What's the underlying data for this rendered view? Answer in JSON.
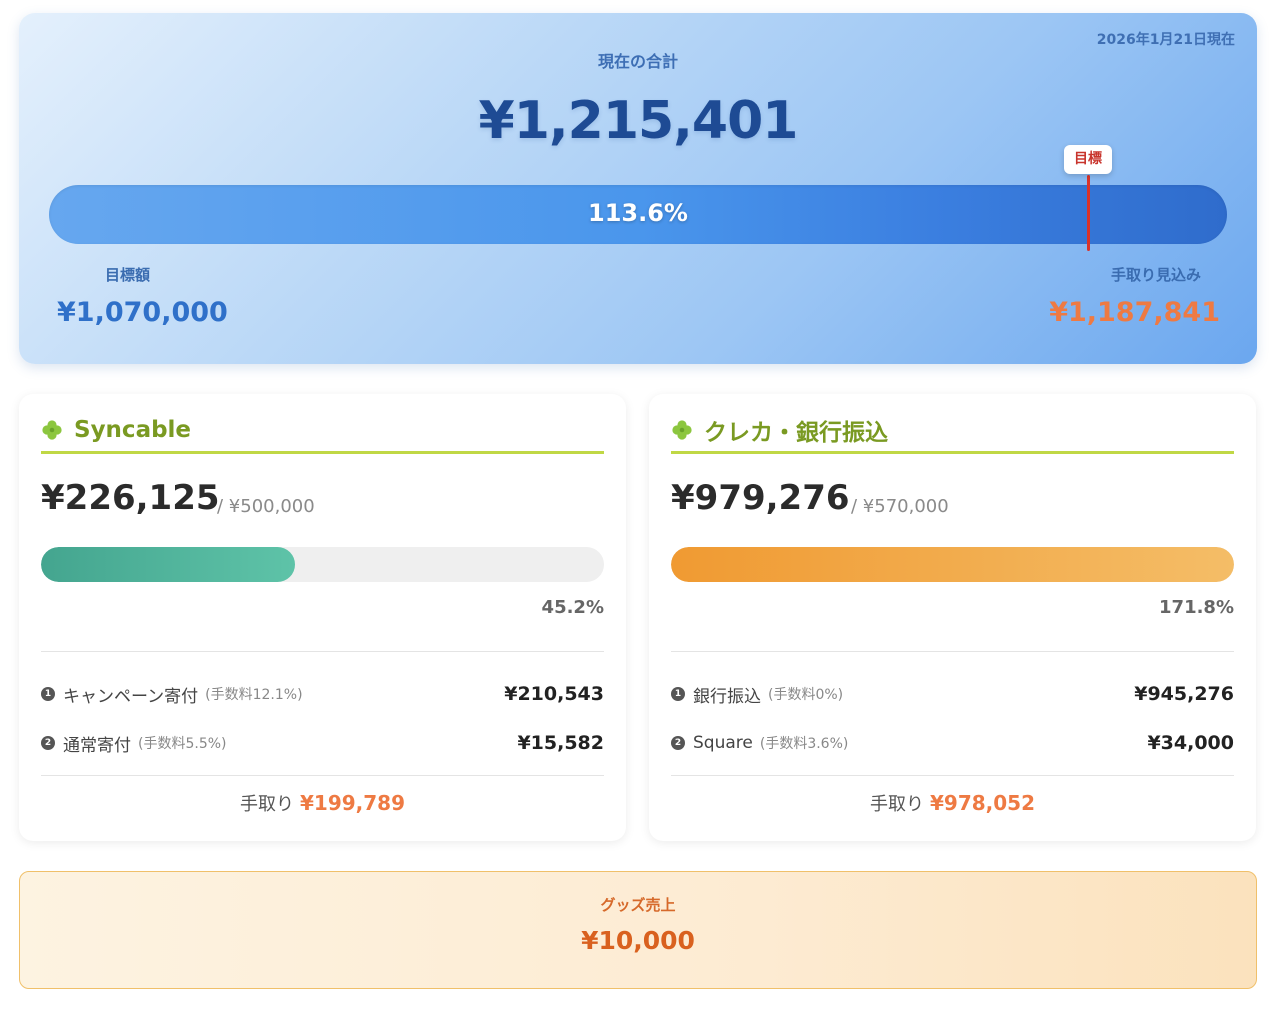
{
  "colors": {
    "hero_total": "#1e4b94",
    "accent_orange": "#ee7a43",
    "goal_marker": "#d9322a",
    "card_title": "#7a9a22",
    "card_title_underline": "#c0d845",
    "syncable_bar": "#4fb59d",
    "bank_bar": "#f2a845"
  },
  "summary": {
    "date": "2026年1月21日現在",
    "label": "現在の合計",
    "total": "¥1,215,401",
    "progress_text": "113.6%",
    "progress_value": 1.136,
    "goal_marker_label": "目標",
    "target_label": "目標額",
    "target_value": "¥1,070,000",
    "net_label": "手取り見込み",
    "net_value": "¥1,187,841"
  },
  "sources": [
    {
      "icon": "clover-icon",
      "title": "Syncable",
      "amount": "¥226,125",
      "target": "/ ¥500,000",
      "progress_text": "45.2%",
      "progress_value": 0.452,
      "items": [
        {
          "num": "1",
          "label": "キャンペーン寄付",
          "fee": "(手数料12.1%)",
          "value": "¥210,543"
        },
        {
          "num": "2",
          "label": "通常寄付",
          "fee": "(手数料5.5%)",
          "value": "¥15,582"
        }
      ],
      "net_label": "手取り",
      "net_value": "¥199,789"
    },
    {
      "icon": "clover-icon",
      "title": "クレカ・銀行振込",
      "amount": "¥979,276",
      "target": "/ ¥570,000",
      "progress_text": "171.8%",
      "progress_value": 1.718,
      "items": [
        {
          "num": "1",
          "label": "銀行振込",
          "fee": "(手数料0%)",
          "value": "¥945,276"
        },
        {
          "num": "2",
          "label": "Square",
          "fee": "(手数料3.6%)",
          "value": "¥34,000"
        }
      ],
      "net_label": "手取り",
      "net_value": "¥978,052"
    }
  ],
  "goods": {
    "label": "グッズ売上",
    "value": "¥10,000"
  }
}
